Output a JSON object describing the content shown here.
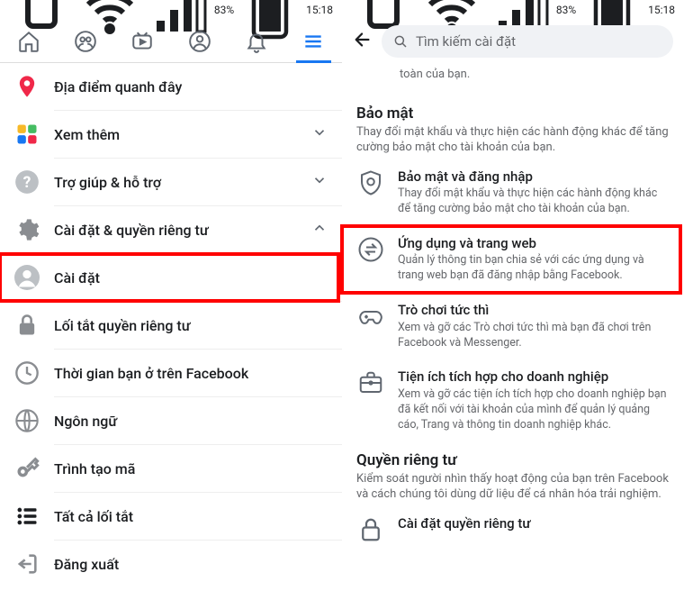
{
  "status": {
    "battery": "83%",
    "time": "15:18"
  },
  "left": {
    "rows": [
      {
        "icon": "pin",
        "label": "Địa điểm quanh đây"
      },
      {
        "icon": "apps",
        "label": "Xem thêm",
        "chev": "down"
      },
      {
        "icon": "help",
        "label": "Trợ giúp & hỗ trợ",
        "chev": "down"
      },
      {
        "icon": "gear",
        "label": "Cài đặt & quyền riêng tư",
        "chev": "up"
      },
      {
        "icon": "avatar",
        "label": "Cài đặt",
        "highlight": true
      },
      {
        "icon": "lock",
        "label": "Lối tắt quyền riêng tư"
      },
      {
        "icon": "clock",
        "label": "Thời gian bạn ở trên Facebook"
      },
      {
        "icon": "globe",
        "label": "Ngôn ngữ"
      },
      {
        "icon": "key",
        "label": "Trình tạo mã"
      },
      {
        "icon": "list",
        "label": "Tất cả lối tắt"
      },
      {
        "icon": "logout",
        "label": "Đăng xuất"
      }
    ]
  },
  "right": {
    "search_placeholder": "Tìm kiếm cài đặt",
    "partial_desc_tail": "toàn của bạn.",
    "sections": [
      {
        "title": "Bảo mật",
        "desc": "Thay đổi mật khẩu và thực hiện các hành động khác để tăng cường bảo mật cho tài khoản của bạn.",
        "items": [
          {
            "icon": "shield",
            "title": "Bảo mật và đăng nhập",
            "desc": "Thay đổi mật khẩu và thực hiện các hành động khác để tăng cường bảo mật cho tài khoản của bạn."
          },
          {
            "icon": "swap",
            "title": "Ứng dụng và trang web",
            "desc": "Quản lý thông tin bạn chia sẻ với các ứng dụng và trang web bạn đã đăng nhập bằng Facebook.",
            "highlight": true
          },
          {
            "icon": "gamepad",
            "title": "Trò chơi tức thì",
            "desc": "Xem và gỡ các Trò chơi tức thì mà bạn đã chơi trên Facebook và Messenger."
          },
          {
            "icon": "briefcase",
            "title": "Tiện ích tích hợp cho doanh nghiệp",
            "desc": "Xem và gỡ các tiện ích tích hợp cho doanh nghiệp bạn đã kết nối với tài khoản của mình để quản lý quảng cáo, Trang và thông tin doanh nghiệp khác."
          }
        ]
      },
      {
        "title": "Quyền riêng tư",
        "desc": "Kiểm soát người nhìn thấy hoạt động của bạn trên Facebook và cách chúng tôi dùng dữ liệu để cá nhân hóa trải nghiệm.",
        "items": [
          {
            "icon": "lock2",
            "title": "Cài đặt quyền riêng tư",
            "desc": ""
          }
        ]
      }
    ]
  }
}
